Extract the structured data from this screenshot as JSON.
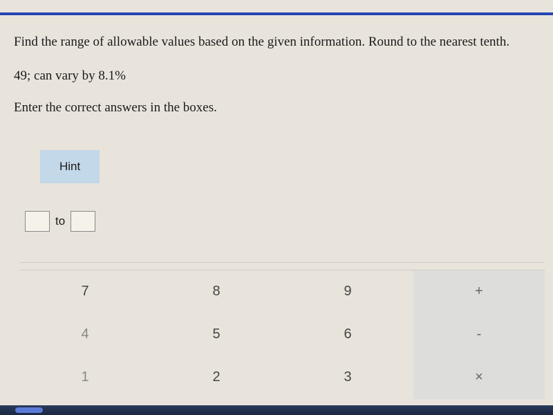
{
  "question": {
    "main": "Find the range of allowable values based on the given information. Round to the nearest tenth.",
    "sub": "49; can vary by 8.1%",
    "instruction": "Enter the correct answers in the boxes."
  },
  "hint": {
    "label": "Hint"
  },
  "answer": {
    "input1_value": "",
    "to_label": "to",
    "input2_value": ""
  },
  "keypad": {
    "rows": [
      {
        "keys": [
          "7",
          "8",
          "9",
          "+"
        ]
      },
      {
        "keys": [
          "4",
          "5",
          "6",
          "-"
        ]
      },
      {
        "keys": [
          "1",
          "2",
          "3",
          "×"
        ]
      }
    ]
  }
}
